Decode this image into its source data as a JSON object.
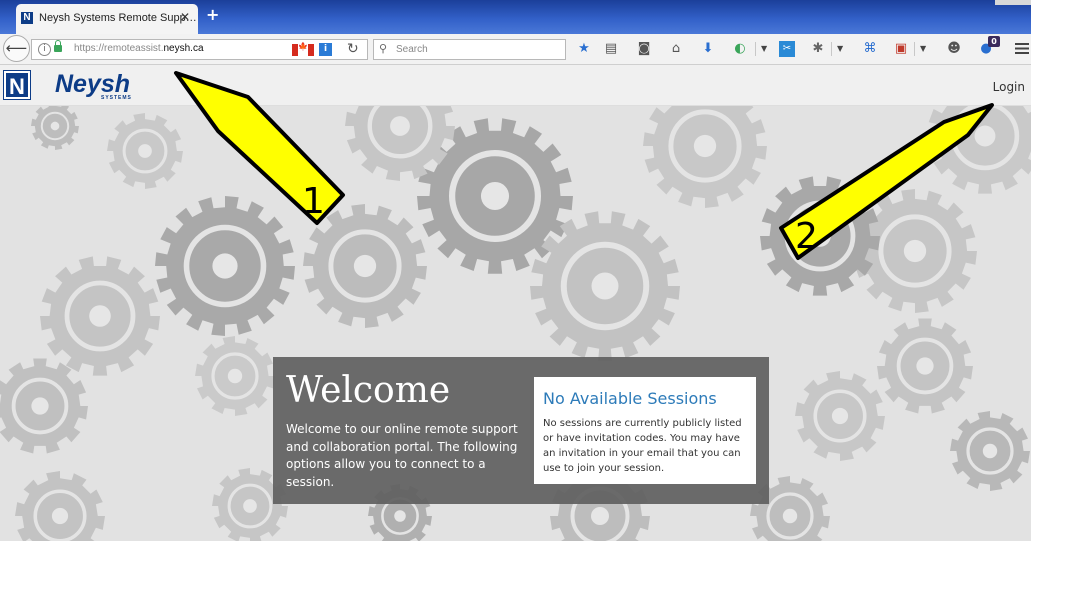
{
  "browser": {
    "tab_title": "Neysh Systems Remote Supp…",
    "tab_close": "✕",
    "new_tab": "+",
    "url_prefix": "https://remoteassist.",
    "url_host": "neysh.ca",
    "search_placeholder": "Search",
    "notification_count": "0"
  },
  "header": {
    "logo_letter": "N",
    "logo_name": "Neysh",
    "logo_sub": "SYSTEMS",
    "login_label": "Login"
  },
  "welcome": {
    "title": "Welcome",
    "text": "Welcome to our online remote support and collaboration portal. The following options allow you to connect to a session."
  },
  "sessions": {
    "title": "No Available Sessions",
    "text": "No sessions are currently publicly listed or have invitation codes. You may have an invitation in your email that you can use to join your session."
  },
  "annotations": {
    "arrow_1": "1",
    "arrow_2": "2",
    "color": "#ffff00"
  },
  "colors": {
    "brand": "#0d3c87",
    "link": "#2d7bb9"
  }
}
